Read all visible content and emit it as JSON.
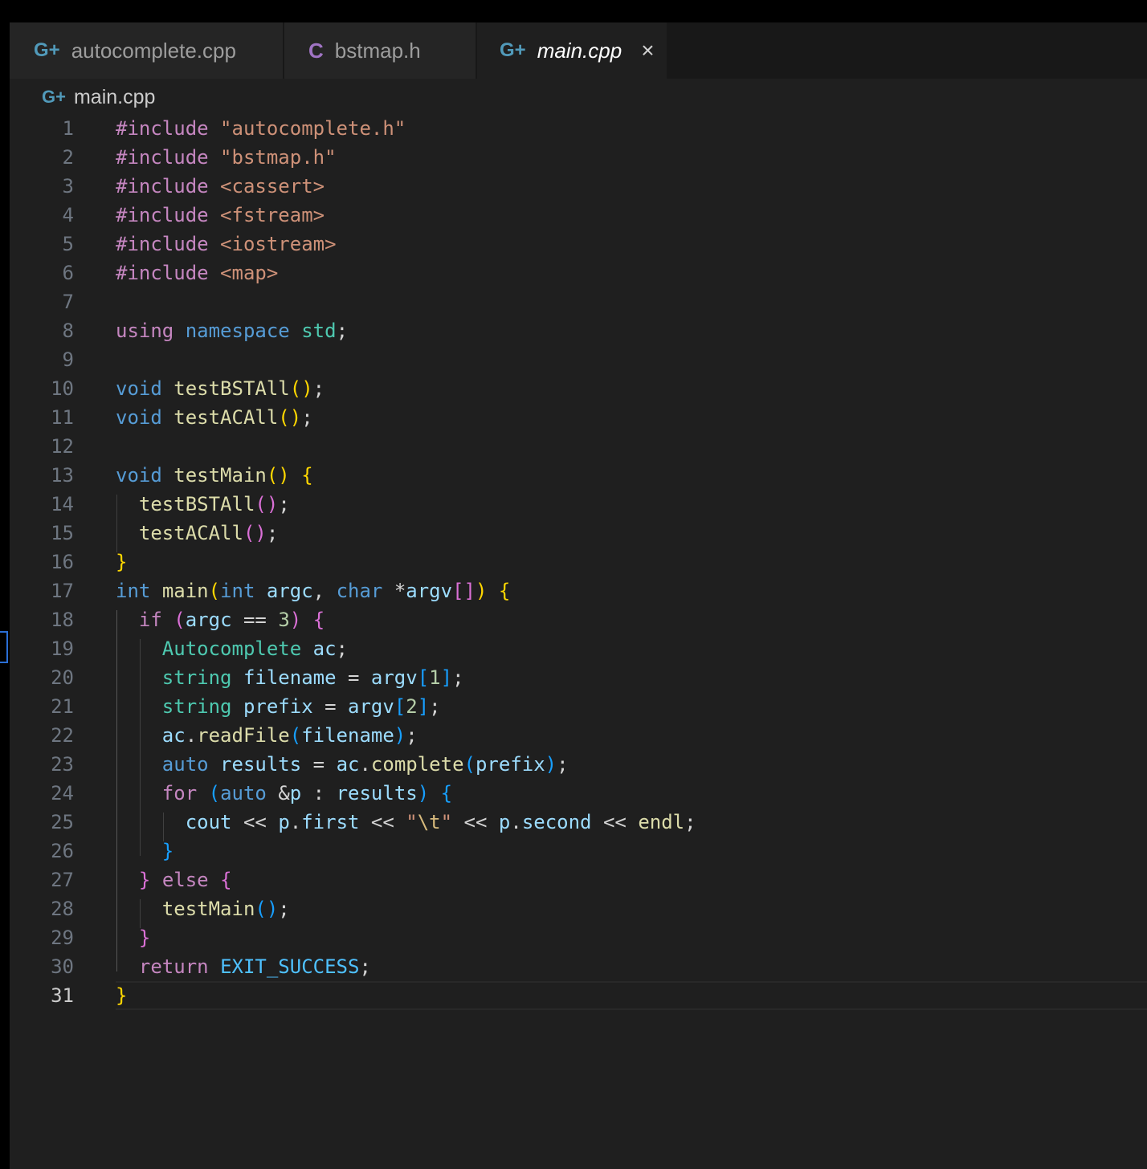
{
  "tabs": [
    {
      "label": "autocomplete.cpp",
      "icon": "cpp-file-icon",
      "active": false
    },
    {
      "label": "bstmap.h",
      "icon": "c-header-file-icon",
      "active": false
    },
    {
      "label": "main.cpp",
      "icon": "cpp-file-icon",
      "active": true
    }
  ],
  "breadcrumb": {
    "file": "main.cpp"
  },
  "editor": {
    "current_line": 31,
    "line_numbers": [
      "1",
      "2",
      "3",
      "4",
      "5",
      "6",
      "7",
      "8",
      "9",
      "10",
      "11",
      "12",
      "13",
      "14",
      "15",
      "16",
      "17",
      "18",
      "19",
      "20",
      "21",
      "22",
      "23",
      "24",
      "25",
      "26",
      "27",
      "28",
      "29",
      "30",
      "31"
    ]
  },
  "icons": {
    "cpp": "G+",
    "c": "C",
    "close": "×"
  },
  "colors": {
    "background": "#1f1f1f",
    "tabbar": "#181818",
    "keyword_purple": "#c586c0",
    "keyword_blue": "#569cd6",
    "string": "#ce9178",
    "function": "#dcdcaa",
    "variable": "#9cdcfe",
    "type": "#4ec9b0"
  }
}
